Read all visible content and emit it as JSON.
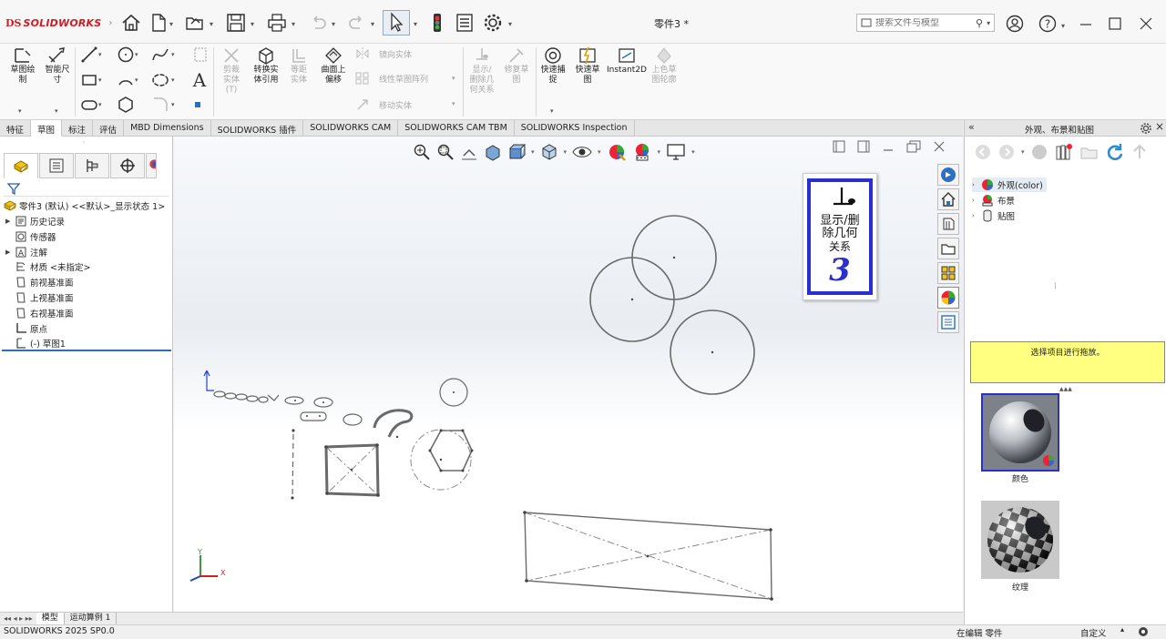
{
  "app": {
    "logo_prefix": "DS",
    "logo_name": "SOLIDWORKS",
    "document_title": "零件3 *"
  },
  "search": {
    "placeholder": "搜索文件与模型"
  },
  "ribbon": {
    "sketch_label": "草图绘制",
    "smart_dim_label": "智能尺寸",
    "trim_label": "剪裁实体(T)",
    "convert_label": "转换实体引用",
    "offset_label": "等距实体",
    "offset_surface_label": "曲面上偏移",
    "mirror_label": "镜向实体",
    "linear_pattern_label": "线性草图阵列",
    "move_label": "移动实体",
    "display_relations_label": "显示/删除几何关系",
    "repair_label": "修复草图",
    "quick_snaps_label": "快速捕捉",
    "rapid_sketch_label": "快速草图",
    "instant2d_label": "Instant2D",
    "shaded_contours_label": "上色草图轮廓"
  },
  "cmd_tabs": [
    "特征",
    "草图",
    "标注",
    "评估",
    "MBD Dimensions",
    "SOLIDWORKS 插件",
    "SOLIDWORKS CAM",
    "SOLIDWORKS CAM TBM",
    "SOLIDWORKS Inspection"
  ],
  "feature_tree": {
    "root": "零件3 (默认) <<默认>_显示状态 1>",
    "items": [
      {
        "label": "历史记录",
        "expandable": true,
        "icon": "history-icon"
      },
      {
        "label": "传感器",
        "expandable": false,
        "icon": "sensor-icon"
      },
      {
        "label": "注解",
        "expandable": true,
        "icon": "annotation-icon"
      },
      {
        "label": "材质 <未指定>",
        "expandable": false,
        "icon": "material-icon"
      },
      {
        "label": "前视基准面",
        "expandable": false,
        "icon": "plane-icon"
      },
      {
        "label": "上视基准面",
        "expandable": false,
        "icon": "plane-icon"
      },
      {
        "label": "右视基准面",
        "expandable": false,
        "icon": "plane-icon"
      },
      {
        "label": "原点",
        "expandable": false,
        "icon": "origin-icon"
      },
      {
        "label": "(-) 草图1",
        "expandable": false,
        "icon": "sketch-icon"
      }
    ]
  },
  "badge": {
    "line1": "显示/删",
    "line2": "除几何",
    "line3": "关系",
    "number": "3"
  },
  "task_pane": {
    "title": "外观、布景和贴图",
    "tree": [
      {
        "label": "外观(color)",
        "icon": "appearance-icon"
      },
      {
        "label": "布景",
        "icon": "scene-icon"
      },
      {
        "label": "贴图",
        "icon": "decal-icon"
      }
    ],
    "message": "选择项目进行拖放。",
    "swatches": [
      {
        "label": "颜色",
        "selected": true
      },
      {
        "label": "纹理",
        "selected": false
      }
    ]
  },
  "bottom_tabs": [
    "模型",
    "运动算例 1"
  ],
  "status": {
    "version": "SOLIDWORKS 2025 SP0.0",
    "mode": "在编辑 零件",
    "units": "自定义"
  },
  "colors": {
    "brand_red": "#d01c22",
    "message_yellow": "#ffff80",
    "selection_blue": "#2a2fcf"
  }
}
